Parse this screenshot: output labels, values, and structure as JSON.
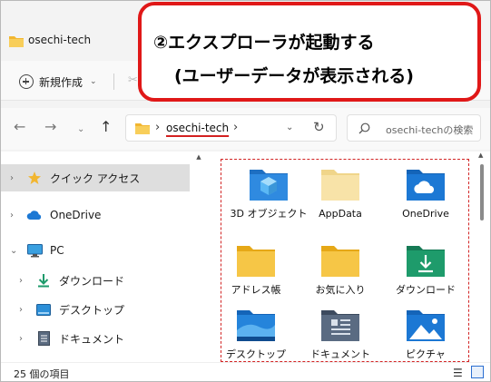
{
  "window": {
    "title": "osechi-tech"
  },
  "toolbar": {
    "new_label": "新規作成"
  },
  "address": {
    "path": "osechi-tech"
  },
  "search": {
    "placeholder": "osechi-techの検索"
  },
  "sidebar": {
    "items": [
      {
        "label": "クイック アクセス",
        "icon": "star-icon",
        "selected": true
      },
      {
        "label": "OneDrive",
        "icon": "cloud-icon",
        "selected": false
      },
      {
        "label": "PC",
        "icon": "monitor-icon",
        "selected": false
      },
      {
        "label": "ダウンロード",
        "icon": "download-icon",
        "selected": false
      },
      {
        "label": "デスクトップ",
        "icon": "desktop-icon",
        "selected": false
      },
      {
        "label": "ドキュメント",
        "icon": "document-icon",
        "selected": false
      }
    ]
  },
  "content": {
    "items": [
      {
        "label": "3D オブジェクト",
        "icon": "3d-objects-folder-icon"
      },
      {
        "label": "AppData",
        "icon": "folder-icon"
      },
      {
        "label": "OneDrive",
        "icon": "onedrive-folder-icon"
      },
      {
        "label": "アドレス帳",
        "icon": "folder-icon"
      },
      {
        "label": "お気に入り",
        "icon": "folder-icon"
      },
      {
        "label": "ダウンロード",
        "icon": "downloads-folder-icon"
      },
      {
        "label": "デスクトップ",
        "icon": "desktop-folder-icon"
      },
      {
        "label": "ドキュメント",
        "icon": "documents-folder-icon"
      },
      {
        "label": "ピクチャ",
        "icon": "pictures-folder-icon"
      }
    ]
  },
  "status": {
    "item_count": "25 個の項目"
  },
  "callout": {
    "line1": "②エクスプローラが起動する",
    "line2": "(ユーザーデータが表示される)",
    "border_color": "#e01818"
  },
  "colors": {
    "folder_yellow": "#f6c646",
    "accent_blue": "#1c78d4",
    "dashed_box": "#d22424"
  }
}
